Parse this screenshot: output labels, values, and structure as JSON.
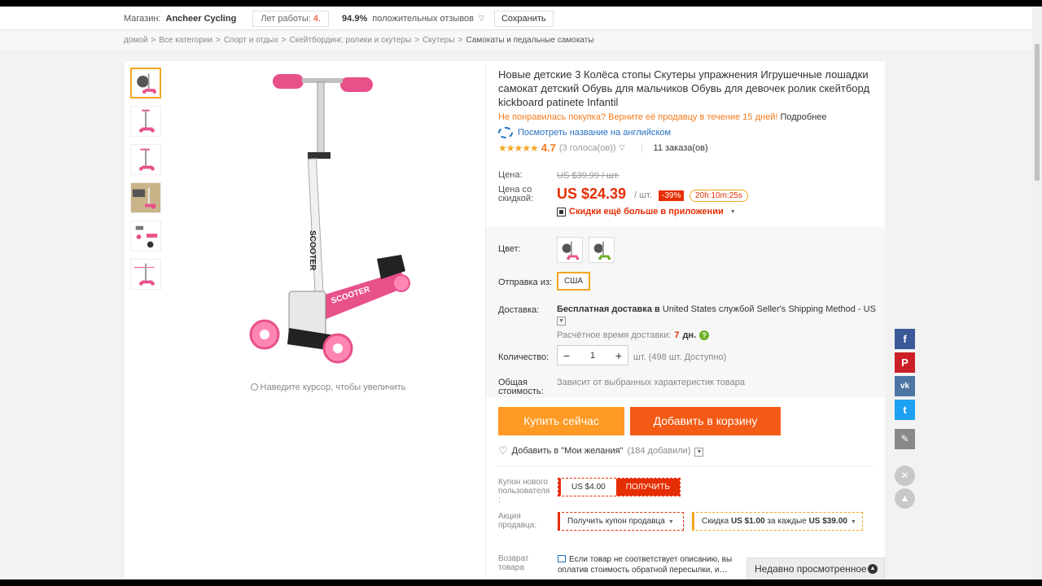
{
  "store": {
    "label": "Магазин:",
    "name": "Ancheer Cycling",
    "years_label": "Лет работы:",
    "years_value": "4",
    "years_dot": ".",
    "positive_pct": "94.9%",
    "positive_text": "положительных отзывов",
    "save_label": "Сохранить"
  },
  "breadcrumb": {
    "items": [
      "домой",
      "Все категории",
      "Спорт и отдых",
      "Скейтбординг, ролики и скутеры",
      "Скутеры",
      "Самокаты и педальные самокаты"
    ],
    "separator": ">"
  },
  "gallery": {
    "zoom_hint": "Наведите курсор, чтобы увеличить",
    "thumbnails": [
      "scooter-pink-1",
      "scooter-pink-2",
      "scooter-pink-3",
      "scooter-photo-4",
      "scooter-parts-5",
      "scooter-pink-6"
    ]
  },
  "product": {
    "title": "Новые детские 3 Колёса стопы Скутеры упражнения Игрушечные лошадки самокат детский Обувь для мальчиков Обувь для девочек ролик скейтборд kickboard patinete Infantil",
    "return_text": "Не понравилась покупка? Верните её продавцу в течение 15 дней!",
    "return_more": "Подробнее",
    "translate": "Посмотреть название на английском",
    "stars": "★★★★★",
    "score": "4.7",
    "votes": "(3 голоса(ов))",
    "orders": "11 заказа(ов)"
  },
  "price": {
    "price_label": "Цена:",
    "old_price": "US $39.99 / шт.",
    "discount_label_1": "Цена со",
    "discount_label_2": "скидкой:",
    "new_price": "US $24.39",
    "per": "/ шт.",
    "discount": "-39%",
    "timer": "20h:10m:25s",
    "app_discount": "Скидки ещё больше в приложении"
  },
  "options": {
    "color_label": "Цвет:",
    "ship_from_label": "Отправка из:",
    "ship_from_value": "США",
    "delivery_label": "Доставка:",
    "delivery_bold": "Бесплатная доставка в",
    "delivery_rest": " United States службой Seller's Shipping Method - US",
    "est_label": "Расчётное время доставки:",
    "est_days": "7",
    "est_unit": "дн.",
    "qty_label": "Количество:",
    "qty_minus": "−",
    "qty_value": "1",
    "qty_plus": "+",
    "stock": "шт. (498 шт. Доступно)",
    "total_label_1": "Общая",
    "total_label_2": "стоимость:",
    "total_value": "Зависит от выбранных характеристик товара"
  },
  "actions": {
    "buy_now": "Купить сейчас",
    "add_to_cart": "Добавить в корзину",
    "wishlist": "Добавить в \"Мои желания\"",
    "wishlist_count": "(184 добавили)"
  },
  "coupons": {
    "new_user_label_1": "Купон нового",
    "new_user_label_2": "пользователя",
    "new_user_label_3": ":",
    "coupon_value": "US $4.00",
    "coupon_get": "ПОЛУЧИТЬ",
    "seller_label_1": "Акция",
    "seller_label_2": "продавца:",
    "seller_coupon": "Получить купон продавца",
    "seller_discount_pre": "Скидка ",
    "seller_discount_amount": "US $1.00",
    "seller_discount_mid": " за каждые ",
    "seller_discount_threshold": "US $39.00",
    "return_label_1": "Возврат",
    "return_label_2": "товара",
    "return_policy": "Если товар не соответствует описанию, вы оплатив стоимость обратной пересылки, и…"
  },
  "share": {
    "facebook": "f",
    "pinterest": "P",
    "vk": "vk",
    "twitter": "t",
    "edit": "✎",
    "close": "×",
    "up": "▲"
  },
  "recently_viewed": "Недавно просмотренное",
  "colors": {
    "accent": "#e62e04",
    "orange": "#ff9a24",
    "cart": "#f45b16",
    "link": "#2470c2"
  }
}
